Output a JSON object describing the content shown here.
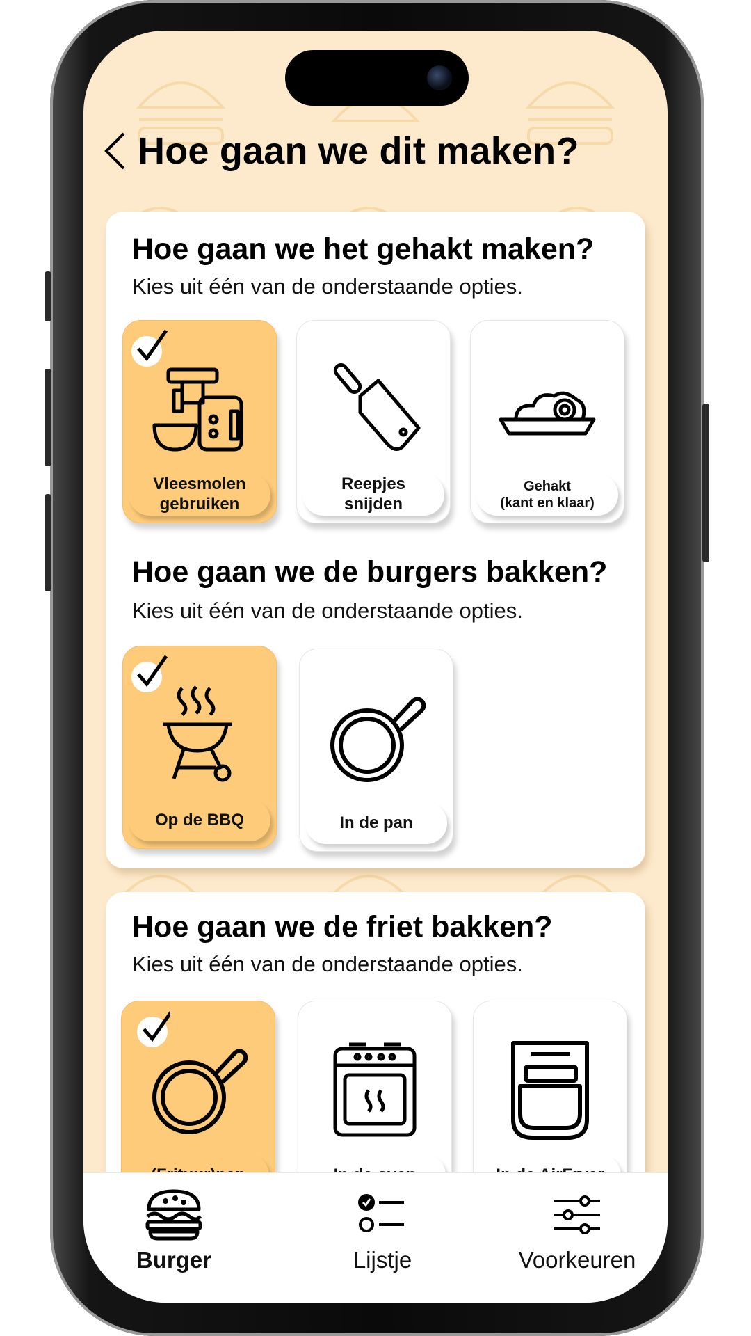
{
  "header": {
    "title": "Hoe gaan we dit maken?"
  },
  "sections": [
    {
      "title": "Hoe gaan we het gehakt maken?",
      "subtitle": "Kies uit één van de onderstaande opties.",
      "options": [
        {
          "label": "Vleesmolen\ngebruiken",
          "icon": "meat-grinder-icon",
          "selected": true
        },
        {
          "label": "Reepjes\nsnijden",
          "icon": "cleaver-icon",
          "selected": false
        },
        {
          "label": "Gehakt\n(kant en klaar)",
          "icon": "mince-tray-icon",
          "selected": false
        }
      ]
    },
    {
      "title": "Hoe gaan we de burgers bakken?",
      "subtitle": "Kies uit één van de onderstaande opties.",
      "options": [
        {
          "label": "Op de BBQ",
          "icon": "bbq-grill-icon",
          "selected": true
        },
        {
          "label": "In de pan",
          "icon": "frying-pan-icon",
          "selected": false
        }
      ]
    },
    {
      "title": "Hoe gaan we de friet bakken?",
      "subtitle": "Kies uit één van de onderstaande opties.",
      "options": [
        {
          "label": "(Frituur)pan",
          "icon": "frying-pan-icon",
          "selected": true
        },
        {
          "label": "In de oven",
          "icon": "oven-icon",
          "selected": false
        },
        {
          "label": "In de AirFryer",
          "icon": "airfryer-icon",
          "selected": false
        }
      ]
    }
  ],
  "nav": [
    {
      "label": "Burger",
      "icon": "burger-icon",
      "active": true
    },
    {
      "label": "Lijstje",
      "icon": "checklist-icon",
      "active": false
    },
    {
      "label": "Voorkeuren",
      "icon": "sliders-icon",
      "active": false
    }
  ],
  "colors": {
    "background": "#fde9cc",
    "selected": "#fecb7a",
    "card": "#ffffff",
    "text": "#000000"
  }
}
